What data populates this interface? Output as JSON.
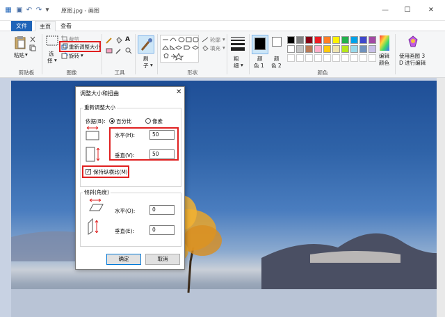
{
  "window": {
    "title": "原图.jpg - 画图",
    "minimize_glyph": "—",
    "maximize_glyph": "☐",
    "close_glyph": "✕"
  },
  "menu": {
    "tabs": [
      "文件",
      "主页",
      "查看"
    ]
  },
  "ribbon": {
    "clipboard": {
      "paste": "粘贴",
      "group": "剪贴板"
    },
    "image": {
      "select": "选",
      "select2": "择",
      "crop": "裁剪",
      "resize": "重新调整大小",
      "rotate": "旋转",
      "group": "图像"
    },
    "tools": {
      "group": "工具"
    },
    "brushes": {
      "label": "刷",
      "label2": "子"
    },
    "shapes": {
      "outline": "轮廓",
      "fill": "填充",
      "group": "形状"
    },
    "size": {
      "label": "粗",
      "label2": "细"
    },
    "colors": {
      "color1": "颜",
      "color1b": "色 1",
      "color2": "颜",
      "color2b": "色 2",
      "edit": "编辑",
      "edit2": "颜色",
      "paint3d": "使用画图 3",
      "paint3d2": "D 进行编辑",
      "group": "颜色",
      "palette_row1": [
        "#000000",
        "#7f7f7f",
        "#880015",
        "#ed1c24",
        "#ff7f27",
        "#fff200",
        "#22b14c",
        "#00a2e8",
        "#3f48cc",
        "#a349a4"
      ],
      "palette_row2": [
        "#ffffff",
        "#c3c3c3",
        "#b97a57",
        "#ffaec9",
        "#ffc90e",
        "#efe4b0",
        "#b5e61d",
        "#99d9ea",
        "#7092be",
        "#c8bfe7"
      ],
      "color1_value": "#000000",
      "color2_value": "#ffffff"
    }
  },
  "dialog": {
    "title": "调整大小和扭曲",
    "close": "✕",
    "resize_section": "重新调整大小",
    "by_label": "依据(B):",
    "percent": "百分比",
    "pixels": "像素",
    "horizontal_label": "水平(H):",
    "horizontal_value": "50",
    "vertical_label": "垂直(V):",
    "vertical_value": "50",
    "keep_ratio": "保持纵横比(M)",
    "skew_section": "倾斜(角度)",
    "skew_h_label": "水平(O):",
    "skew_h_value": "0",
    "skew_v_label": "垂直(E):",
    "skew_v_value": "0",
    "ok": "确定",
    "cancel": "取消"
  }
}
